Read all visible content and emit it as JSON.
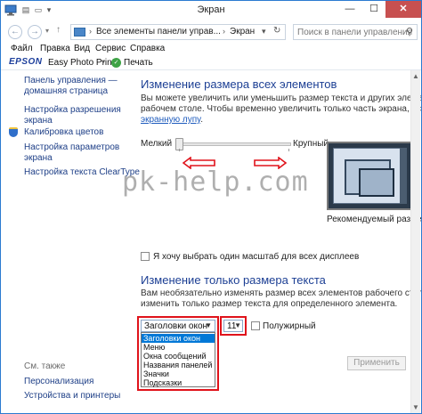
{
  "window": {
    "title": "Экран",
    "controls": {
      "minimize": "—",
      "maximize": "☐",
      "close": "✕"
    }
  },
  "address": {
    "crumbs": [
      "Все элементы панели управ...",
      "Экран"
    ],
    "search_placeholder": "Поиск в панели управления"
  },
  "menu": [
    "Файл",
    "Правка",
    "Вид",
    "Сервис",
    "Справка"
  ],
  "epson": {
    "logo": "EPSON",
    "app": "Easy Photo Print",
    "print": "Печать"
  },
  "sidebar": {
    "links": [
      "Панель управления —",
      "домашняя страница",
      "Настройка разрешения",
      "экрана",
      "Калибровка цветов",
      "Настройка параметров",
      "экрана",
      "Настройка текста ClearType"
    ],
    "see_also": "См. также",
    "bottom_links": [
      "Персонализация",
      "Устройства и принтеры"
    ]
  },
  "main": {
    "section1_title": "Изменение размера всех элементов",
    "section1_text_line1": "Вы можете увеличить или уменьшить размер текста и других элементов на",
    "section1_text_line2": "рабочем столе. Чтобы временно увеличить только часть экрана, используйте",
    "magnifier_link": "экранную лупу",
    "magnifier_tail": ".",
    "slider_small": "Мелкий",
    "slider_large": "Крупный",
    "slider_level": 0,
    "recommended": "Рекомендуемый размер",
    "checkbox_scale": "Я хочу выбрать один масштаб для всех дисплеев",
    "section2_title": "Изменение только размера текста",
    "section2_text_line1": "Вам необязательно изменять размер всех элементов рабочего стола — можно",
    "section2_text_line2": "изменить только размер текста для определенного элемента.",
    "element_select_value": "Заголовки окон",
    "size_select_value": "11",
    "bold_label": "Полужирный",
    "dropdown_options": [
      "Заголовки окон",
      "Меню",
      "Окна сообщений",
      "Названия панелей",
      "Значки",
      "Подсказки"
    ],
    "apply_button": "Применить"
  },
  "watermark": "pk-help.com",
  "colors": {
    "accent": "#1c3f94",
    "link": "#1e3f87",
    "highlight_red": "#e0131b",
    "selection": "#0078d7"
  }
}
